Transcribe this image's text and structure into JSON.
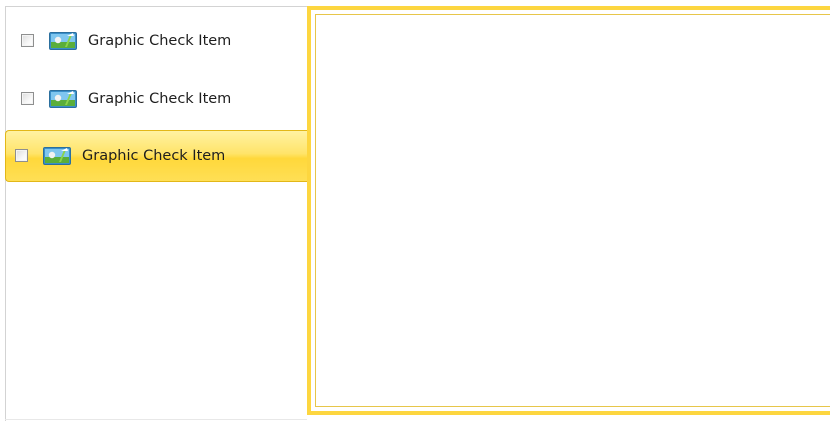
{
  "list": {
    "items": [
      {
        "label": "Graphic Check Item",
        "icon": "picture-icon",
        "checked": false,
        "selected": false
      },
      {
        "label": "Graphic Check Item",
        "icon": "picture-icon",
        "checked": false,
        "selected": false
      },
      {
        "label": "Graphic Check Item",
        "icon": "picture-icon",
        "checked": false,
        "selected": true
      }
    ]
  },
  "colors": {
    "selection": "#ffdf55",
    "selection_border": "#e2b718",
    "panel_border": "#fdd63f",
    "pane_border": "#d3d3d3"
  }
}
